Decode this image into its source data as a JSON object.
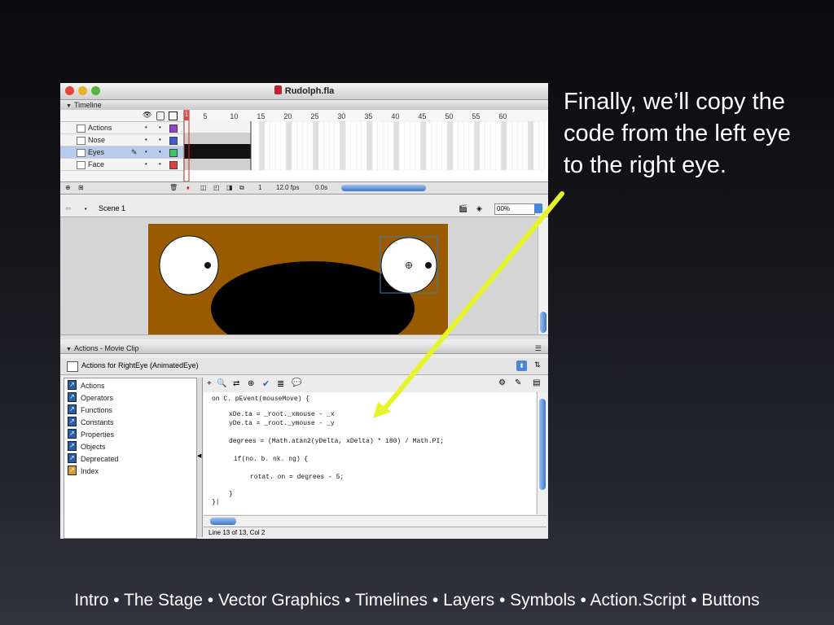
{
  "window": {
    "title": "Rudolph.fla"
  },
  "timeline": {
    "header": "Timeline",
    "frame_numbers": [
      "1",
      "5",
      "10",
      "15",
      "20",
      "25",
      "30",
      "35",
      "40",
      "45",
      "50",
      "55",
      "60"
    ],
    "layers": [
      {
        "name": "Actions",
        "color": "#9b3fd0"
      },
      {
        "name": "Nose",
        "color": "#3f5bd8"
      },
      {
        "name": "Eyes",
        "color": "#3fc86a"
      },
      {
        "name": "Face",
        "color": "#e04040"
      }
    ],
    "current_frame": "1",
    "fps": "12.0 fps",
    "time": "0.0s"
  },
  "edit_bar": {
    "scene": "Scene 1",
    "zoom": "00%"
  },
  "actions_panel": {
    "header": "Actions - Movie Clip",
    "target": "Actions for RightEye (AnimatedEye)",
    "toolbox": [
      "Actions",
      "Operators",
      "Functions",
      "Constants",
      "Properties",
      "Objects",
      "Deprecated",
      "Index"
    ],
    "code_lines": [
      "on C. pEvent(mouseMove) {",
      "xDe.ta = _root._xmouse - _x",
      "yDe.ta = _root._ymouse - _y",
      "degrees = (Math.atan2(yDelta, xDelta) * 180) / Math.PI;",
      "if(no. b. nk. ng) {",
      "rotat. on = degrees - 5;",
      "}",
      "}|"
    ],
    "status": "Line 13 of 13, Col 2"
  },
  "callout": "Finally, we’ll copy the code from the left eye to the right eye.",
  "footer": "Intro • The Stage • Vector Graphics • Timelines • Layers • Symbols • Action.Script • Buttons",
  "colors": {
    "face": "#9a5a00",
    "arrow": "#e6f52a",
    "selection": "#3c7fb1"
  }
}
